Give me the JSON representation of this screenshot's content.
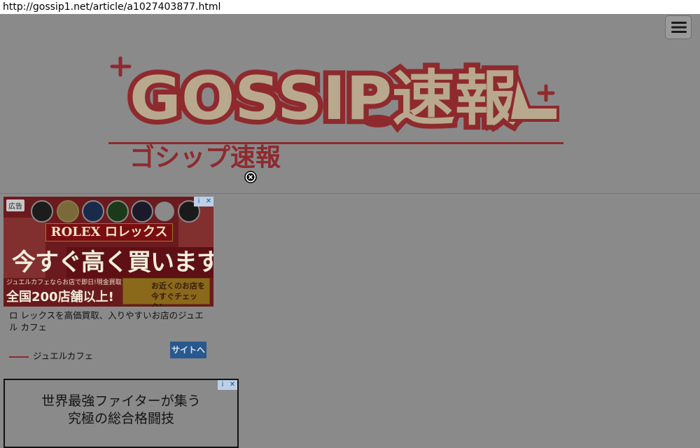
{
  "browser": {
    "url": "http://gossip1.net/article/a1027403877.html"
  },
  "header": {
    "logo_text": "GOSSIP速報",
    "logo_subtitle": "ゴシップ速報",
    "menu_icon": "hamburger-menu-icon",
    "close_icon": "close-circle-icon"
  },
  "ad1": {
    "label": "広告",
    "banner_brand": "ROLEX ロレックス",
    "headline": "今すぐ高く買います!",
    "sub_text": "ジュエルカフェならお店で即日!現金買取!",
    "stores_text": "全国200店舗以上!",
    "bubble_text": "お近くのお店を今すぐチェック!",
    "description": "ロ レックスを高価買取、入りやすいお店のジュエル カフェ",
    "brand": "ジュエルカフェ",
    "cta": "サイトへ"
  },
  "ad2": {
    "line1": "世界最強ファイターが集う",
    "line2": "究極の総合格闘技"
  },
  "colors": {
    "overlay": "#8a8a8a",
    "logo_red": "#8e2a2e",
    "logo_beige": "#b8a88e",
    "cta_blue": "#29588e"
  }
}
